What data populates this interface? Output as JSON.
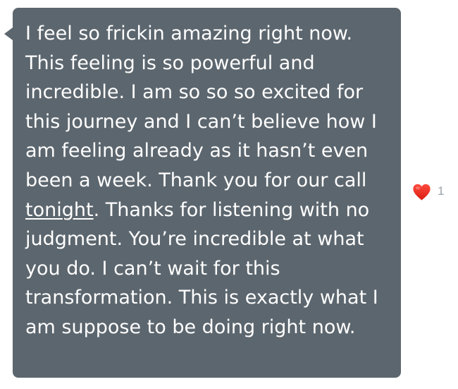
{
  "message": {
    "text_before": "I feel so frickin amazing right now. This feeling is so powerful and incredible. I am so so so excited for this journey and I can’t believe how I am feeling already as it hasn’t even been a week. Thank you for our call ",
    "link_text": "tonight",
    "text_after": ". Thanks for listening with no judgment. You’re incredible at what you do. I can’t wait for this transformation. This is exactly what I am suppose to be doing right now.",
    "bubble_color": "#5c666e",
    "text_color": "#ffffff"
  },
  "reaction": {
    "icon": "heart-icon",
    "count": "1",
    "heart_color": "#e8281c"
  }
}
